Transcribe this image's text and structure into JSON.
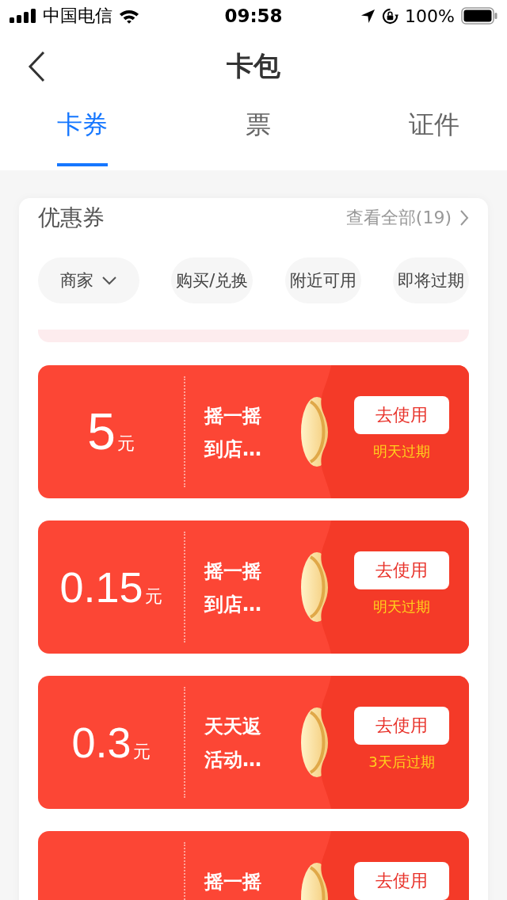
{
  "status_bar": {
    "carrier": "中国电信",
    "time": "09:58",
    "battery": "100%"
  },
  "nav": {
    "title": "卡包"
  },
  "tabs": [
    {
      "label": "卡券",
      "selected": true
    },
    {
      "label": "票",
      "selected": false
    },
    {
      "label": "证件",
      "selected": false
    }
  ],
  "section": {
    "title": "优惠券",
    "link": "查看全部(19)"
  },
  "filters": [
    {
      "label": "商家",
      "kind": "dropdown"
    },
    {
      "label": "购买/兑换",
      "kind": "chip"
    },
    {
      "label": "附近可用",
      "kind": "chip"
    },
    {
      "label": "即将过期",
      "kind": "chip"
    }
  ],
  "coupons": [
    {
      "amount": "5",
      "unit": "元",
      "title": "摇一摇到店…",
      "button": "去使用",
      "expiry": "明天过期"
    },
    {
      "amount": "0.15",
      "unit": "元",
      "title": "摇一摇到店…",
      "button": "去使用",
      "expiry": "明天过期"
    },
    {
      "amount": "0.3",
      "unit": "元",
      "title": "天天返活动…",
      "button": "去使用",
      "expiry": "3天后过期"
    },
    {
      "title": "摇一摇",
      "button": "去使用"
    }
  ]
}
